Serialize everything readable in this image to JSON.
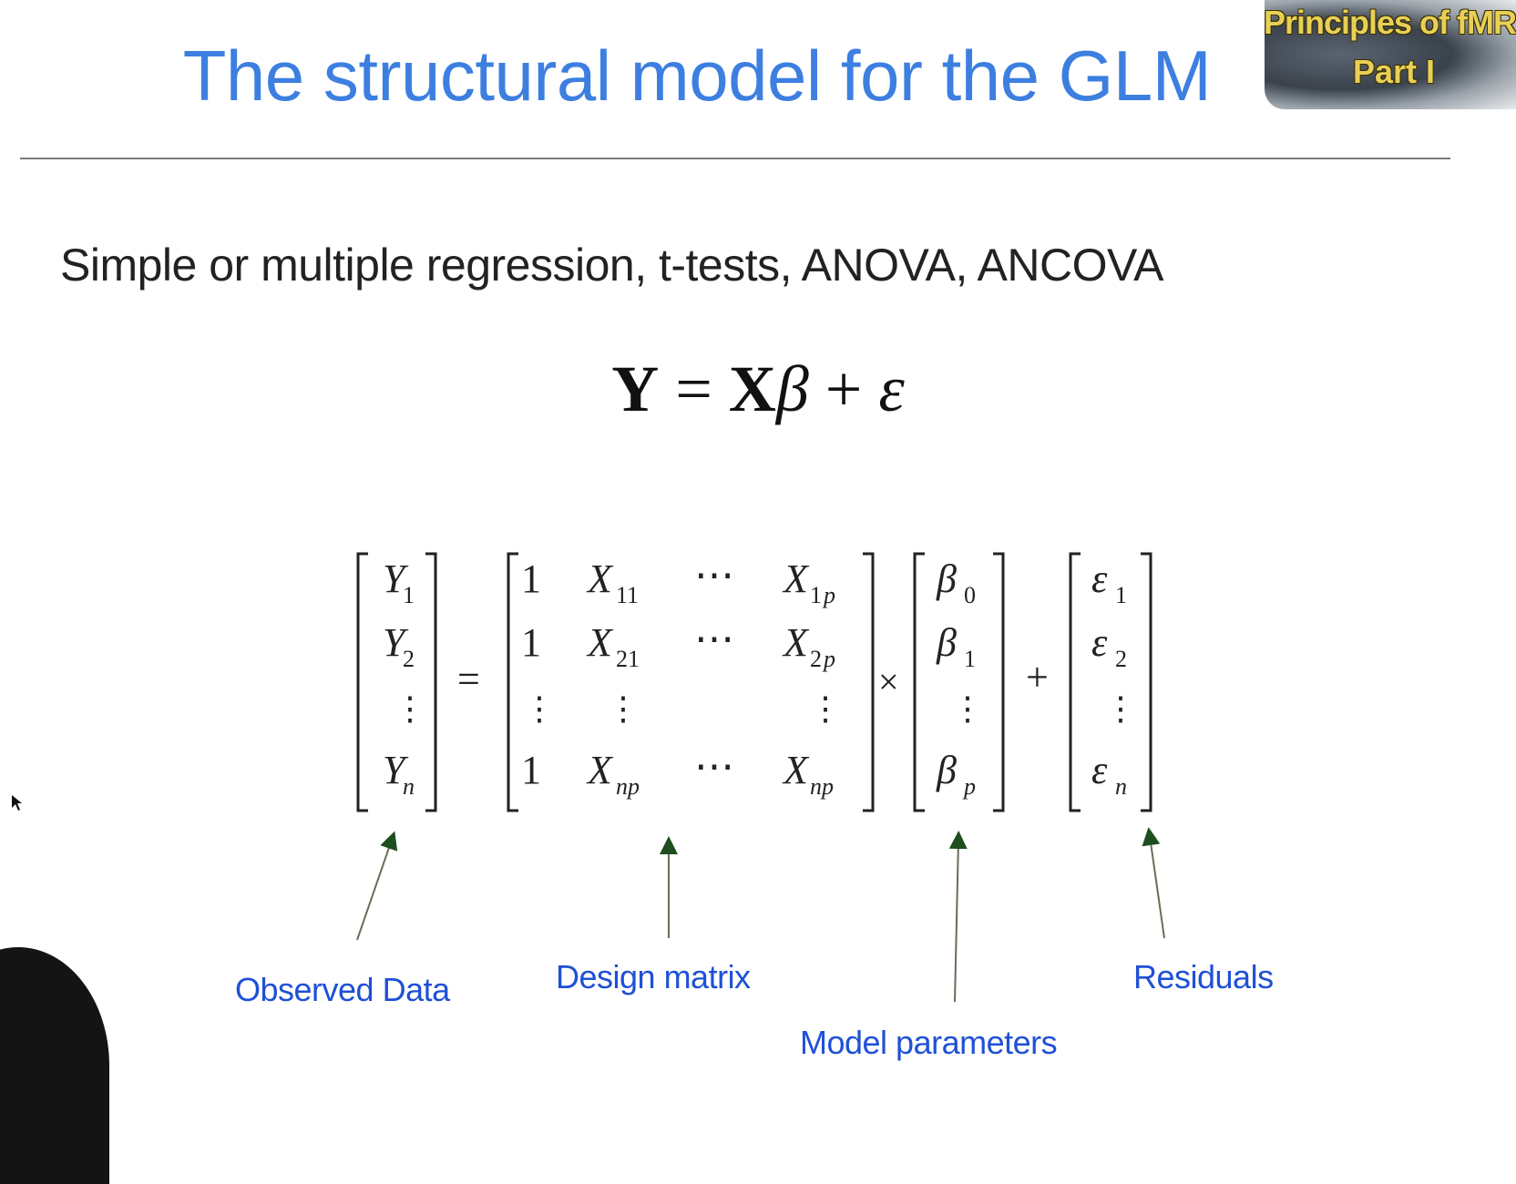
{
  "slide": {
    "title": "The structural model for the GLM",
    "badge": {
      "line1": "Principles of fMRI",
      "line2": "Part I"
    },
    "subtitle": "Simple or multiple regression, t-tests, ANOVA, ANCOVA",
    "formula": {
      "Y": "Y",
      "eq": "=",
      "X": "X",
      "beta": "β",
      "plus": "+",
      "eps": "ε"
    },
    "labels": {
      "observed": "Observed Data",
      "design": "Design matrix",
      "params": "Model parameters",
      "residuals": "Residuals"
    },
    "colors": {
      "title": "#3d7fe0",
      "label": "#1f50d6",
      "arrow": "#6b6b5a"
    }
  }
}
